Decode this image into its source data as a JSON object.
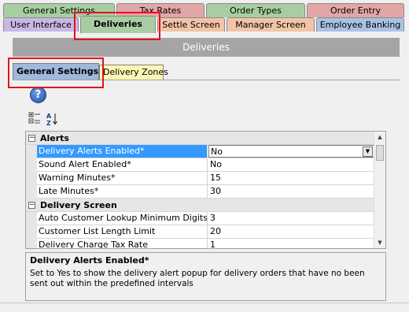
{
  "top_tabs_row1": [
    {
      "label": "General Settings",
      "color": "green"
    },
    {
      "label": "Tax Rates",
      "color": "pink"
    },
    {
      "label": "Order Types",
      "color": "green"
    },
    {
      "label": "Order Entry",
      "color": "pink"
    }
  ],
  "top_tabs_row2": [
    {
      "label": "User Interface",
      "color": "purple"
    },
    {
      "label": "Deliveries",
      "color": "green",
      "active": true
    },
    {
      "label": "Settle Screen",
      "color": "peach"
    },
    {
      "label": "Manager Screen",
      "color": "peach"
    },
    {
      "label": "Employee Banking",
      "color": "blue"
    }
  ],
  "panel": {
    "title": "Deliveries"
  },
  "sub_tabs": [
    {
      "label": "General Settings",
      "active": true
    },
    {
      "label": "Delivery Zones",
      "active": false
    }
  ],
  "help_icon": {
    "glyph": "?"
  },
  "toolbar": {
    "categorized_glyph": "⊞",
    "alphabetical_glyph": "A↓Z"
  },
  "property_grid": {
    "categories": [
      {
        "name": "Alerts",
        "toggle": "⊟",
        "rows": [
          {
            "name": "Delivery Alerts Enabled*",
            "value": "No",
            "selected": true
          },
          {
            "name": "Sound Alert Enabled*",
            "value": "No"
          },
          {
            "name": "Warning Minutes*",
            "value": "15"
          },
          {
            "name": "Late Minutes*",
            "value": "30"
          }
        ]
      },
      {
        "name": "Delivery Screen",
        "toggle": "⊟",
        "rows": [
          {
            "name": "Auto Customer Lookup Minimum Digits",
            "value": "3"
          },
          {
            "name": "Customer List Length Limit",
            "value": "20"
          },
          {
            "name": "Delivery Charge Tax Rate",
            "value": "1"
          }
        ]
      }
    ],
    "dropdown_glyph": "▼",
    "scroll_up_glyph": "▲",
    "scroll_down_glyph": "▼"
  },
  "description": {
    "title": "Delivery Alerts Enabled*",
    "text": "Set to Yes to show the delivery alert popup for delivery orders that have no been sent out within the predefined intervals"
  },
  "colors": {
    "highlight": "#e0141e",
    "selection": "#3399ff",
    "header_bar": "#a5a5a5"
  }
}
